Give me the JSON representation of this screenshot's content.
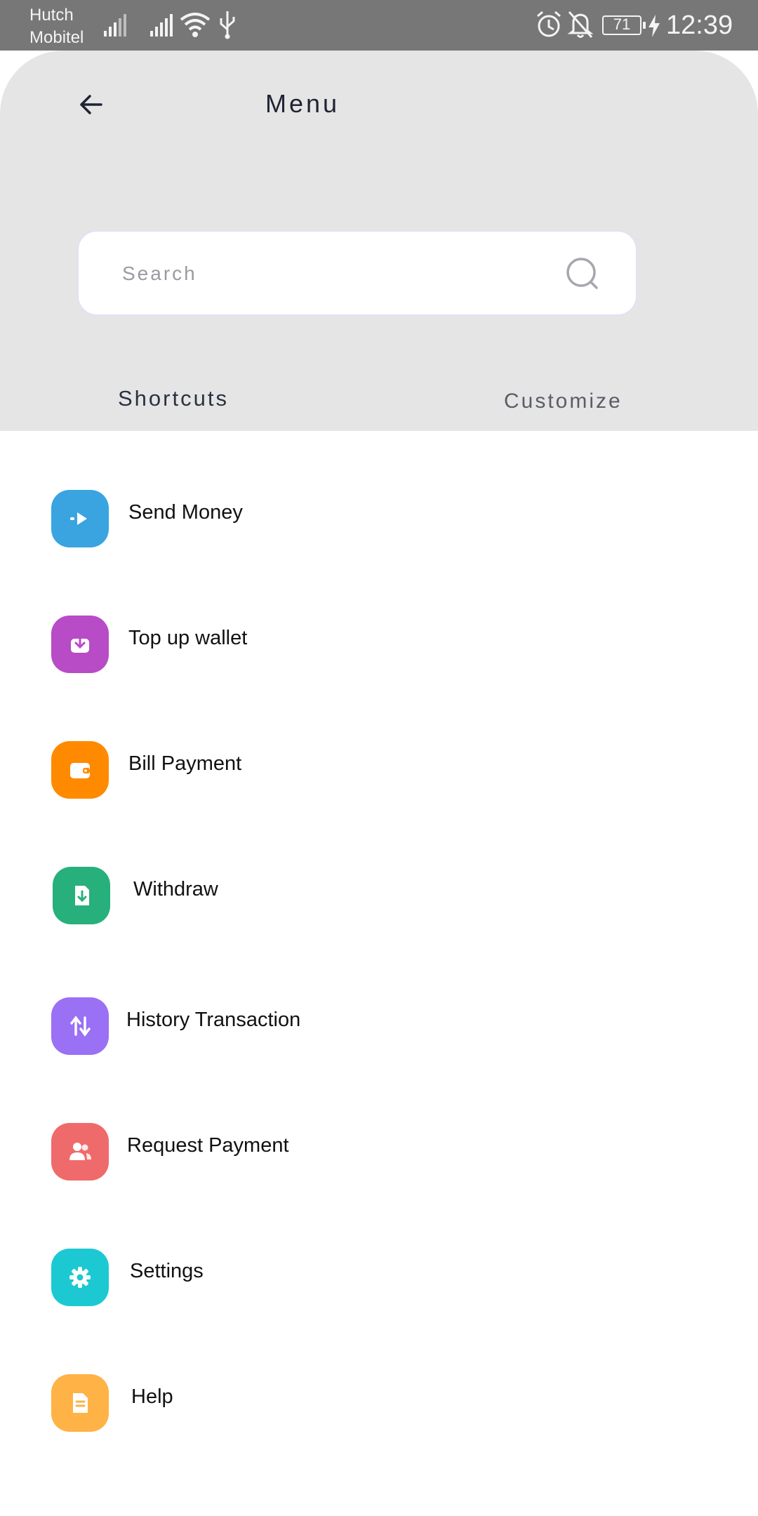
{
  "status_bar": {
    "carrier_line1": "Hutch",
    "carrier_line2": "Mobitel",
    "battery": "71",
    "time": "12:39",
    "icons": [
      "signal-icon",
      "signal-icon",
      "wifi-icon",
      "usb-icon",
      "alarm-icon",
      "bell-off-icon",
      "battery-icon",
      "charging-icon"
    ]
  },
  "header": {
    "title": "Menu",
    "back_icon": "arrow-left-icon"
  },
  "search": {
    "placeholder": "Search",
    "value": "",
    "icon": "search-icon"
  },
  "section": {
    "shortcuts_label": "Shortcuts",
    "customize_label": "Customize"
  },
  "menu": {
    "items": [
      {
        "label": "Send Money",
        "icon": "send-money-icon",
        "color": "#3aa4e0"
      },
      {
        "label": "Top up wallet",
        "icon": "top-up-icon",
        "color": "#b84bc6"
      },
      {
        "label": "Bill Payment",
        "icon": "wallet-icon",
        "color": "#ff8a00"
      },
      {
        "label": "Withdraw",
        "icon": "withdraw-icon",
        "color": "#27b07c"
      },
      {
        "label": "History Transaction",
        "icon": "history-icon",
        "color": "#9a70f5"
      },
      {
        "label": "Request Payment",
        "icon": "request-payment-icon",
        "color": "#ef6b6b"
      },
      {
        "label": "Settings",
        "icon": "gear-icon",
        "color": "#1cc9d2"
      },
      {
        "label": "Help",
        "icon": "help-document-icon",
        "color": "#ffb246"
      }
    ]
  }
}
